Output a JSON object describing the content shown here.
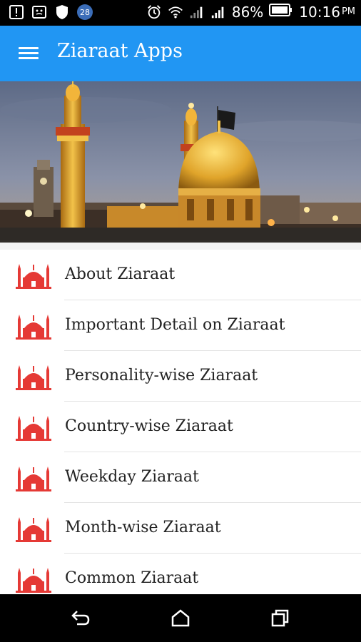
{
  "status_bar": {
    "notification_badge": "28",
    "battery_percent": "86%",
    "time": "10:16",
    "ampm": "PM"
  },
  "app_bar": {
    "title": "Ziaraat Apps",
    "menu_icon": "hamburger-menu-icon"
  },
  "banner": {
    "description_icon": "shrine-banner-image"
  },
  "menu_items": [
    {
      "label": "About Ziaraat",
      "icon": "mosque-icon"
    },
    {
      "label": "Important Detail on Ziaraat",
      "icon": "mosque-icon"
    },
    {
      "label": "Personality-wise Ziaraat",
      "icon": "mosque-icon"
    },
    {
      "label": "Country-wise Ziaraat",
      "icon": "mosque-icon"
    },
    {
      "label": "Weekday Ziaraat",
      "icon": "mosque-icon"
    },
    {
      "label": "Month-wise Ziaraat",
      "icon": "mosque-icon"
    },
    {
      "label": "Common Ziaraat",
      "icon": "mosque-icon"
    }
  ],
  "nav_bar": {
    "back_icon": "back-icon",
    "home_icon": "home-icon",
    "recents_icon": "recents-icon"
  },
  "colors": {
    "app_bar": "#2196f3",
    "mosque_icon": "#e53935",
    "status_bar": "#000000"
  }
}
